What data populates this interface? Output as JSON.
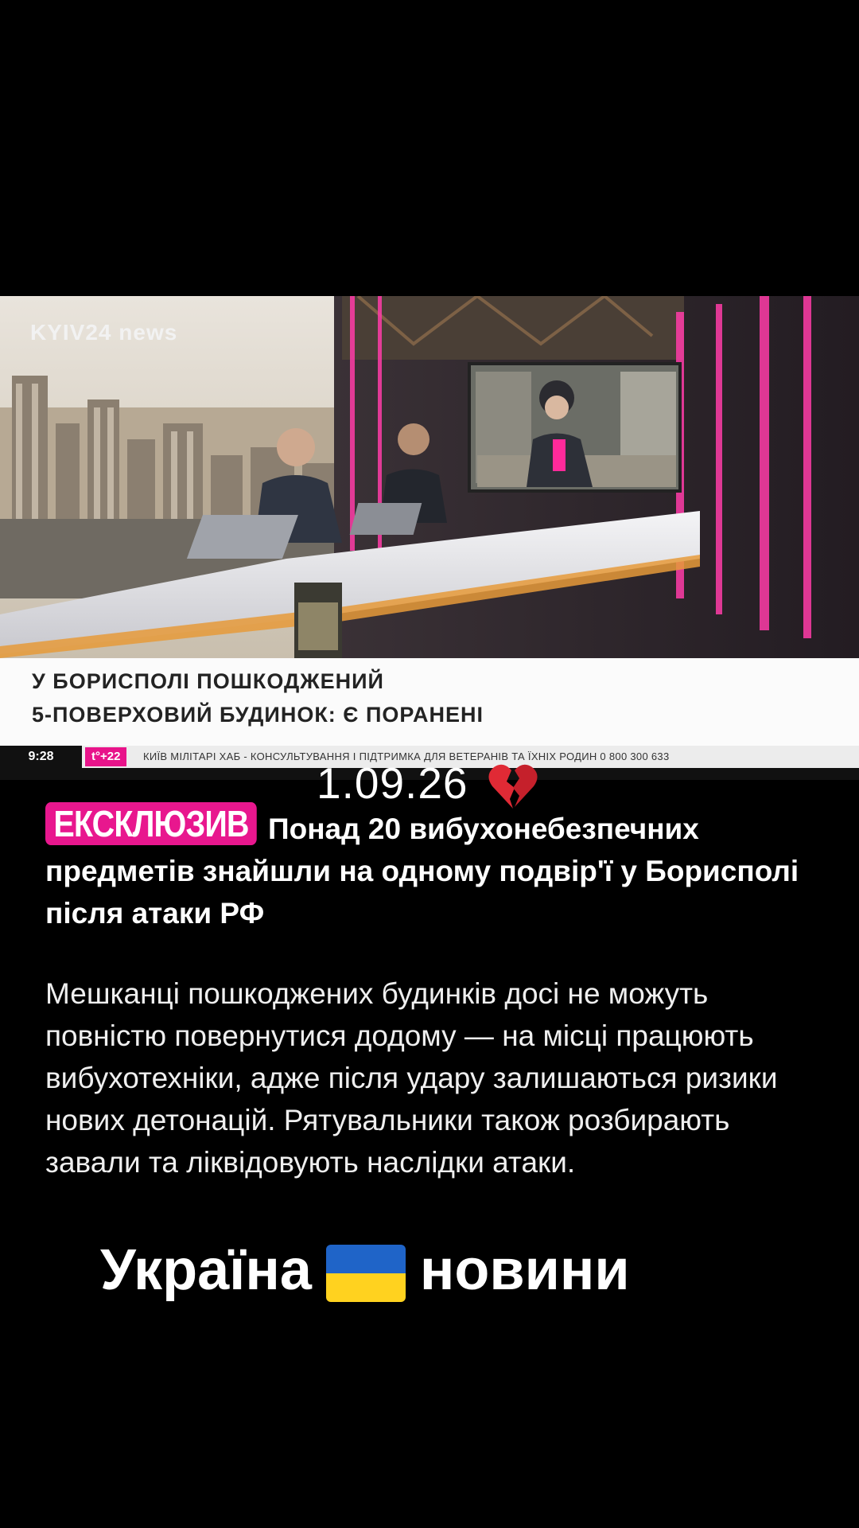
{
  "broadcast": {
    "channel_logo": "KYIV24 news",
    "headline_line1": "У БОРИСПОЛІ ПОШКОДЖЕНИЙ",
    "headline_line2": "5-ПОВЕРХОВИЙ БУДИНОК: Є ПОРАНЕНІ",
    "ticker_time": "9:28",
    "ticker_temp": "t°+22",
    "ticker_text": "КИЇВ МІЛІТАРІ ХАБ - КОНСУЛЬТУВАННЯ І ПІДТРИМКА ДЛЯ ВЕТЕРАНІВ ТА ЇХНІХ РОДИН 0 800 300 633"
  },
  "post": {
    "date": "1.09.26",
    "date_emoji": "broken-heart-icon",
    "badge": "ЕКСКЛЮЗИВ",
    "headline": "Понад 20 вибухонебезпечних предметів знайшли на одному подвір'ї у Борисполі після атаки РФ",
    "body": "Мешканці пошкоджених будинків досі не можуть повністю повернутися додому — на місці працюють вибухотехніки, адже після удару залишаються ризики нових детонацій. Рятувальники також розбирають завали та ліквідовують наслідки атаки.",
    "footer_left": "Україна",
    "footer_flag": "ukraine-flag-icon",
    "footer_right": "новини"
  },
  "colors": {
    "accent_pink": "#e8178e",
    "background": "#000000",
    "flag_blue": "#1f64c8",
    "flag_yellow": "#ffd21f"
  }
}
